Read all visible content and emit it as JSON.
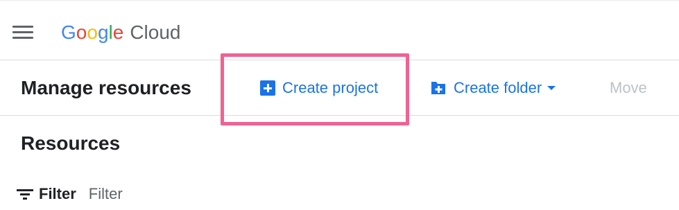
{
  "header": {
    "brand_letters": [
      {
        "char": "G",
        "color": "#4285F4"
      },
      {
        "char": "o",
        "color": "#EA4335"
      },
      {
        "char": "o",
        "color": "#FBBC05"
      },
      {
        "char": "g",
        "color": "#4285F4"
      },
      {
        "char": "l",
        "color": "#34A853"
      },
      {
        "char": "e",
        "color": "#EA4335"
      }
    ],
    "product_name": "Cloud",
    "menu_icon": "hamburger-menu-icon"
  },
  "action_bar": {
    "title": "Manage resources",
    "create_project": {
      "label": "Create project",
      "icon": "add-box-icon"
    },
    "create_folder": {
      "label": "Create folder",
      "icon": "create-new-folder-icon",
      "dropdown_icon": "caret-down-icon"
    },
    "move": {
      "label": "Move",
      "enabled": false
    }
  },
  "resources": {
    "title": "Resources",
    "filter_label": "Filter",
    "filter_placeholder": "Filter",
    "filter_icon": "filter-list-icon"
  },
  "colors": {
    "accent": "#1a73e8",
    "highlight": "#f06292",
    "disabled": "#bdc1c6",
    "divider": "#dadce0"
  }
}
